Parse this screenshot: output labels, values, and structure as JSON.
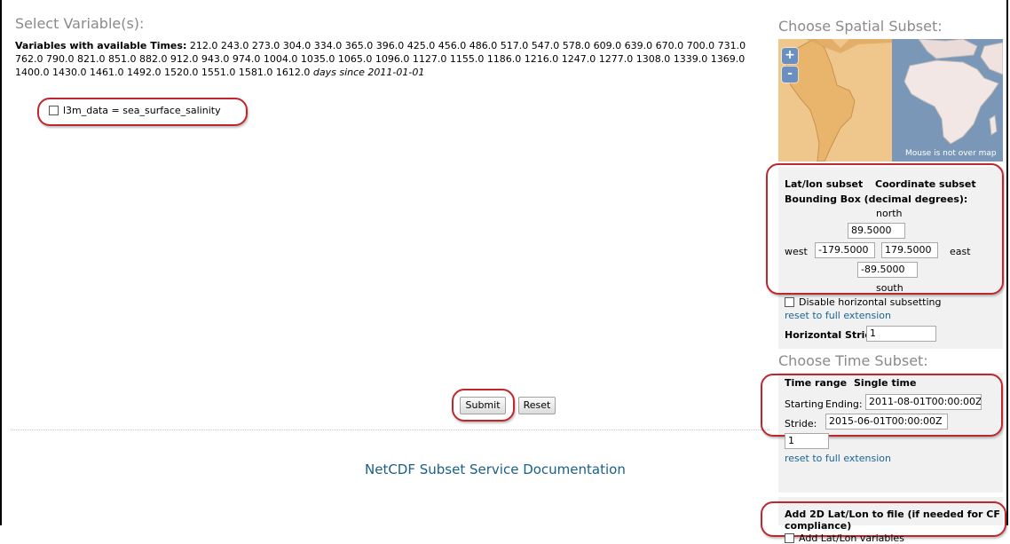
{
  "variables": {
    "title": "Select Variable(s):",
    "times_label": "Variables with available Times:",
    "times_values": "212.0 243.0 273.0 304.0 334.0 365.0 396.0 425.0 456.0 486.0 517.0 547.0 578.0 609.0 639.0 670.0 700.0 731.0 762.0 790.0 821.0 851.0 882.0 912.0 943.0 974.0 1004.0 1035.0 1065.0 1096.0 1127.0 1155.0 1186.0 1216.0 1247.0 1277.0 1308.0 1339.0 1369.0 1400.0 1430.0 1461.0 1492.0 1520.0 1551.0 1581.0 1612.0",
    "times_units": "days since 2011-01-01",
    "var_checkbox_label": "l3m_data = sea_surface_salinity"
  },
  "buttons": {
    "submit": "Submit",
    "reset": "Reset"
  },
  "doc_link": "NetCDF Subset Service Documentation",
  "spatial": {
    "title": "Choose Spatial Subset:",
    "map_status": "Mouse is not over map",
    "zoom_in": "+",
    "zoom_out": "-",
    "tab_latlon": "Lat/lon subset",
    "tab_coord": "Coordinate subset",
    "bbox_label": "Bounding Box (decimal degrees):",
    "north_label": "north",
    "north_value": "89.5000",
    "west_label": "west",
    "west_value": "-179.5000",
    "east_value": "179.5000",
    "east_label": "east",
    "south_value": "-89.5000",
    "south_label": "south",
    "disable_label": "Disable horizontal subsetting",
    "reset_link": "reset to full extension",
    "stride_label": "Horizontal Stride:",
    "stride_value": "1"
  },
  "time": {
    "title": "Choose Time Subset:",
    "tab_range": "Time range",
    "tab_single": "Single time",
    "starting_label": "Starting",
    "ending_label": "Ending:",
    "start_value": "2011-08-01T00:00:00Z",
    "stride_label": "Stride:",
    "end_value": "2015-06-01T00:00:00Z",
    "stride_value": "1",
    "reset_link": "reset to full extension"
  },
  "latlon2d": {
    "label": "Add 2D Lat/Lon to file (if needed for CF compliance)",
    "checkbox_label": "Add Lat/Lon variables"
  },
  "colors": {
    "annotation_oval": "#c0272d",
    "link": "#1a6496",
    "map_land_highlight": "#efc68b",
    "map_ocean": "#7a97b7"
  }
}
